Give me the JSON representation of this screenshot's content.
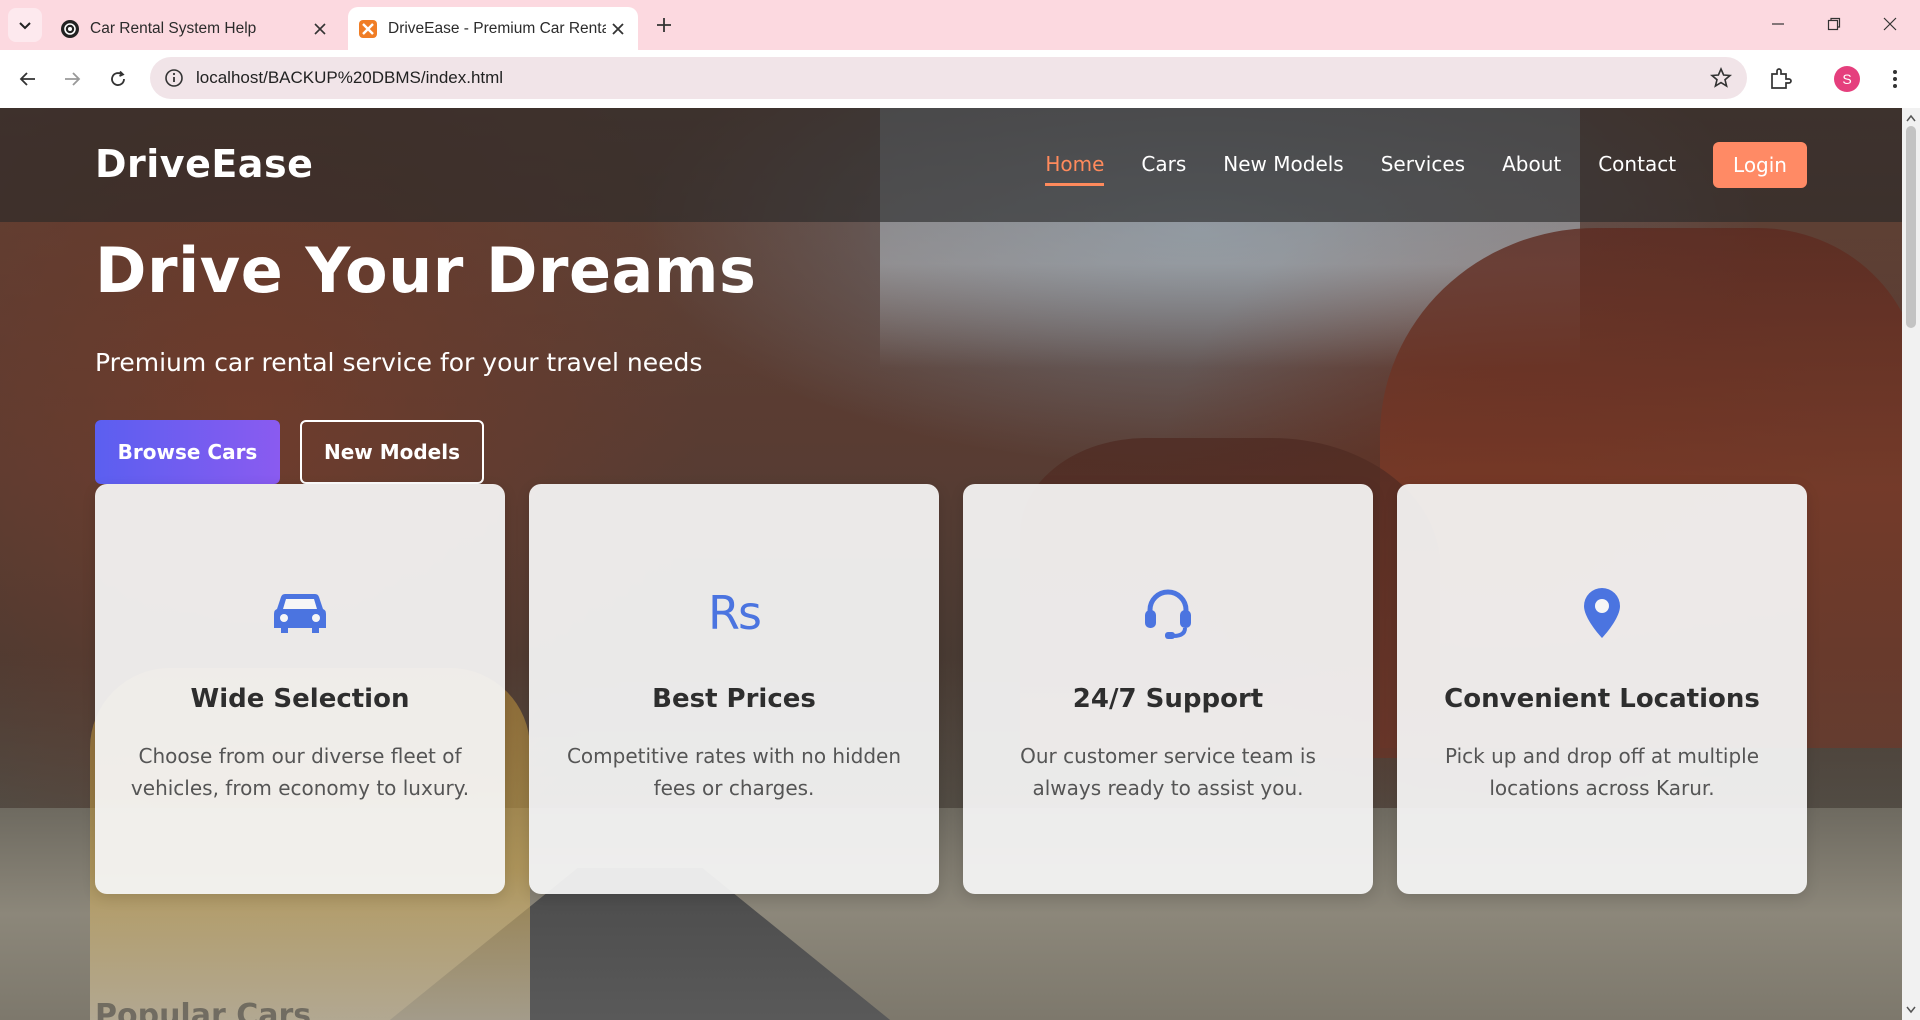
{
  "browser": {
    "tabs": [
      {
        "title": "Car Rental System Help",
        "active": false
      },
      {
        "title": "DriveEase - Premium Car Rental",
        "active": true
      }
    ],
    "address": "localhost/BACKUP%20DBMS/index.html",
    "profile_initial": "S"
  },
  "site": {
    "brand": "DriveEase",
    "nav": [
      "Home",
      "Cars",
      "New Models",
      "Services",
      "About",
      "Contact"
    ],
    "active_nav": "Home",
    "login_label": "Login"
  },
  "hero": {
    "title": "Drive Your Dreams",
    "subtitle": "Premium car rental service for your travel needs",
    "primary_button": "Browse Cars",
    "secondary_button": "New Models"
  },
  "features": [
    {
      "icon": "car-icon",
      "title": "Wide Selection",
      "description": "Choose from our diverse fleet of vehicles, from economy to luxury."
    },
    {
      "icon": "rupee-icon",
      "icon_text": "Rs",
      "title": "Best Prices",
      "description": "Competitive rates with no hidden fees or charges."
    },
    {
      "icon": "headset-icon",
      "title": "24/7 Support",
      "description": "Our customer service team is always ready to assist you."
    },
    {
      "icon": "map-pin-icon",
      "title": "Convenient Locations",
      "description": "Pick up and drop off at multiple locations across Karur."
    }
  ],
  "next_section_title": "Popular Cars",
  "colors": {
    "accent": "#ff8a65",
    "icon_blue": "#4b74e0",
    "primary_gradient_start": "#5b5ff0",
    "primary_gradient_end": "#8a5bf0",
    "tabbar_bg": "#fcd9e0"
  }
}
